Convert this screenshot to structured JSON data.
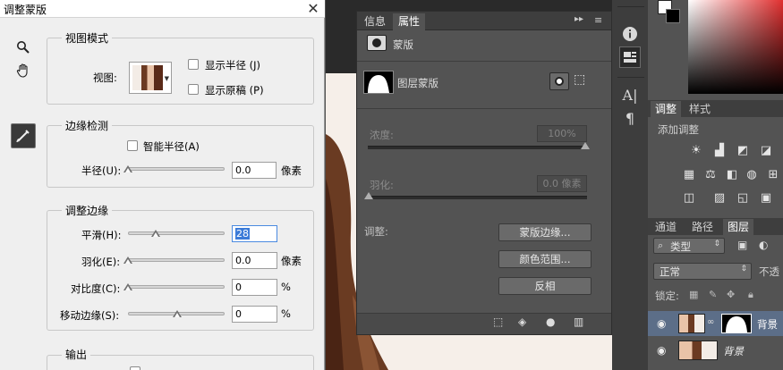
{
  "dialog": {
    "title": "调整蒙版",
    "view_mode": {
      "legend": "视图模式",
      "view_label": "视图:",
      "show_radius": "显示半径 (J)",
      "show_original": "显示原稿 (P)"
    },
    "edge_detection": {
      "legend": "边缘检测",
      "smart_radius": "智能半径(A)",
      "radius_label": "半径(U):",
      "radius_value": "0.0",
      "radius_unit": "像素"
    },
    "adjust_edge": {
      "legend": "调整边缘",
      "smooth_label": "平滑(H):",
      "smooth_value": "28",
      "smooth_level": 28,
      "feather_label": "羽化(E):",
      "feather_value": "0.0",
      "feather_unit": "像素",
      "contrast_label": "对比度(C):",
      "contrast_value": "0",
      "contrast_unit": "%",
      "shift_label": "移动边缘(S):",
      "shift_value": "0",
      "shift_unit": "%"
    },
    "output": {
      "legend": "输出"
    }
  },
  "properties": {
    "tabs": [
      "信息",
      "属性"
    ],
    "section": "蒙版",
    "layer_mask": "图层蒙版",
    "density_label": "浓度:",
    "density_value": "100%",
    "feather_label": "羽化:",
    "feather_value": "0.0 像素",
    "adjust_label": "调整:",
    "buttons": [
      "蒙版边缘...",
      "颜色范围...",
      "反相"
    ]
  },
  "right": {
    "adjust_tabs": [
      "调整",
      "样式"
    ],
    "add_adjust": "添加调整",
    "layer_tabs": [
      "通道",
      "路径",
      "图层"
    ],
    "filter_label": "类型",
    "blend_mode": "正常",
    "opacity_label": "不透",
    "lock_label": "锁定:",
    "layers": [
      {
        "name": "背景"
      },
      {
        "name": "背景"
      }
    ]
  },
  "colors": {
    "accent": "#3b7bd8",
    "panel": "#535353",
    "dialog": "#efefef"
  }
}
